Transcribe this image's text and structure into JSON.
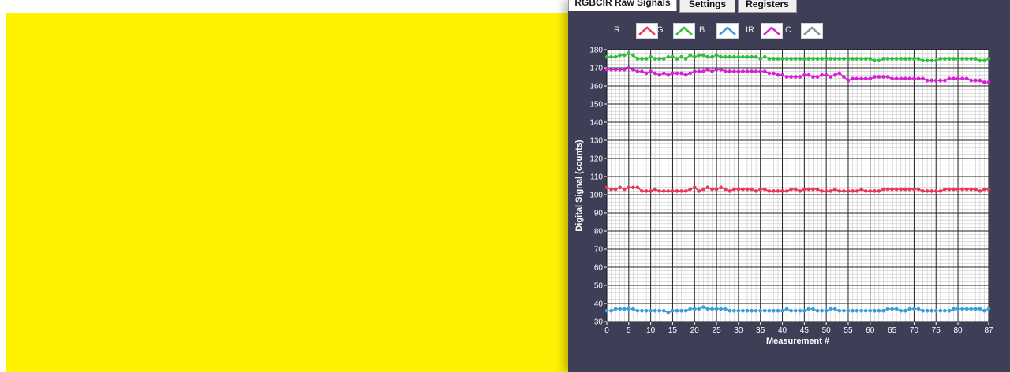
{
  "tabs": [
    {
      "label": "RGBCIR Raw Signals",
      "active": true
    },
    {
      "label": "Settings",
      "active": false
    },
    {
      "label": "Registers",
      "active": false
    }
  ],
  "legend": [
    {
      "label": "R",
      "color": "#e8385a",
      "icon": "line-sample-icon"
    },
    {
      "label": "G",
      "color": "#2dbf3a",
      "icon": "line-sample-icon"
    },
    {
      "label": "B",
      "color": "#3b9ddb",
      "icon": "line-sample-icon"
    },
    {
      "label": "IR",
      "color": "#d61fd6",
      "icon": "line-sample-icon"
    },
    {
      "label": "C",
      "color": "#8f8f8f",
      "icon": "line-sample-icon"
    }
  ],
  "colors": {
    "panel_bg": "#3e3f56",
    "yellow": "#fff200",
    "plot_bg": "#ffffff",
    "grid_major": "#222222",
    "grid_minor": "#c8c8c8"
  },
  "chart_data": {
    "type": "line",
    "xlabel": "Measurement #",
    "ylabel": "Digital Signal  (counts)",
    "xlim": [
      0,
      87
    ],
    "ylim": [
      30,
      180
    ],
    "x_ticks": [
      0,
      5,
      10,
      15,
      20,
      25,
      30,
      35,
      40,
      45,
      50,
      55,
      60,
      65,
      70,
      75,
      80,
      87
    ],
    "y_ticks": [
      30,
      40,
      50,
      60,
      70,
      80,
      90,
      100,
      110,
      120,
      130,
      140,
      150,
      160,
      170,
      180
    ],
    "grid": true,
    "series": [
      {
        "color": "#2dbf3a",
        "values": [
          176,
          176,
          176,
          177,
          177,
          178,
          177,
          175,
          175,
          175,
          176,
          175,
          175,
          175,
          176,
          176,
          175,
          176,
          175,
          177,
          176,
          177,
          177,
          176,
          176,
          177,
          176,
          176,
          176,
          176,
          176,
          176,
          176,
          176,
          176,
          175,
          176,
          175,
          175,
          175,
          175,
          175,
          175,
          175,
          175,
          175,
          175,
          175,
          175,
          175,
          175,
          175,
          175,
          175,
          175,
          175,
          175,
          175,
          175,
          175,
          175,
          174,
          174,
          175,
          175,
          175,
          175,
          175,
          175,
          175,
          175,
          175,
          174,
          174,
          174,
          174,
          175,
          175,
          175,
          175,
          175,
          175,
          175,
          175,
          175,
          174,
          174,
          175
        ]
      },
      {
        "color": "#d61fd6",
        "values": [
          169,
          169,
          169,
          169,
          169,
          170,
          169,
          168,
          168,
          167,
          168,
          167,
          166,
          167,
          166,
          167,
          167,
          167,
          166,
          167,
          168,
          168,
          168,
          169,
          168,
          169,
          169,
          168,
          168,
          168,
          168,
          168,
          168,
          168,
          168,
          168,
          168,
          167,
          167,
          166,
          166,
          165,
          165,
          165,
          165,
          166,
          166,
          165,
          165,
          166,
          166,
          165,
          166,
          167,
          165,
          163,
          164,
          164,
          164,
          164,
          164,
          165,
          165,
          165,
          165,
          164,
          164,
          164,
          164,
          164,
          164,
          164,
          164,
          163,
          163,
          163,
          163,
          163,
          164,
          164,
          164,
          164,
          164,
          163,
          163,
          163,
          162,
          162
        ]
      },
      {
        "color": "#e8385a",
        "values": [
          104,
          103,
          103,
          104,
          103,
          104,
          104,
          104,
          102,
          102,
          102,
          103,
          102,
          102,
          102,
          102,
          102,
          102,
          102,
          103,
          104,
          102,
          103,
          104,
          103,
          103,
          104,
          103,
          102,
          103,
          103,
          103,
          103,
          103,
          102,
          103,
          103,
          102,
          102,
          102,
          102,
          102,
          103,
          103,
          102,
          103,
          103,
          103,
          103,
          102,
          102,
          102,
          103,
          102,
          102,
          102,
          102,
          102,
          103,
          102,
          102,
          102,
          102,
          103,
          103,
          103,
          103,
          103,
          103,
          103,
          103,
          103,
          102,
          102,
          102,
          102,
          102,
          103,
          103,
          103,
          103,
          103,
          103,
          103,
          103,
          102,
          103,
          103
        ]
      },
      {
        "color": "#3b9ddb",
        "values": [
          36,
          36,
          37,
          37,
          37,
          37,
          37,
          36,
          36,
          36,
          36,
          36,
          36,
          36,
          35,
          36,
          36,
          36,
          36,
          37,
          37,
          37,
          38,
          37,
          37,
          37,
          37,
          37,
          36,
          36,
          36,
          36,
          36,
          36,
          36,
          36,
          36,
          36,
          36,
          36,
          36,
          37,
          36,
          36,
          36,
          36,
          37,
          37,
          36,
          36,
          36,
          37,
          37,
          36,
          36,
          36,
          36,
          36,
          36,
          36,
          36,
          36,
          36,
          36,
          37,
          37,
          37,
          36,
          36,
          37,
          37,
          37,
          36,
          36,
          36,
          36,
          36,
          36,
          36,
          37,
          37,
          37,
          37,
          37,
          37,
          37,
          36,
          37
        ]
      }
    ]
  }
}
